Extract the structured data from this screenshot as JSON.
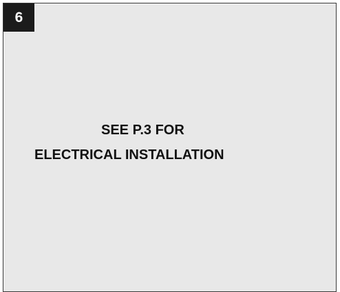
{
  "step": {
    "number": "6"
  },
  "note": {
    "line1": "SEE P.3 FOR",
    "line2": "ELECTRICAL INSTALLATION"
  }
}
